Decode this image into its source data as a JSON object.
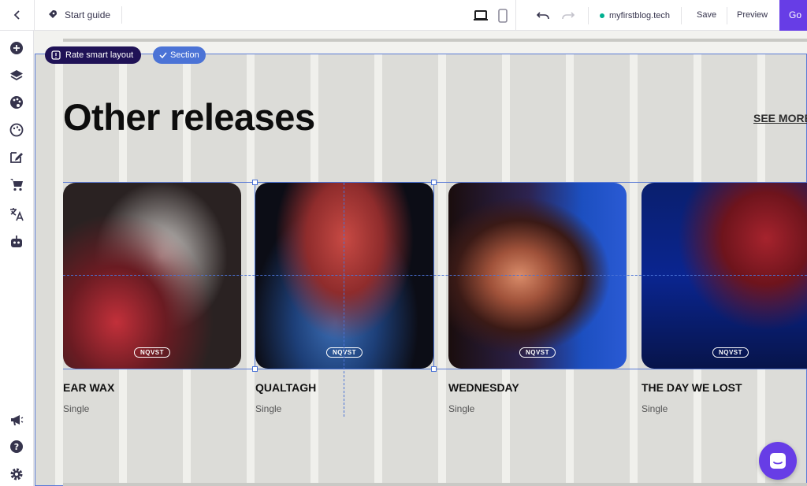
{
  "topbar": {
    "start_guide": "Start guide",
    "domain": "myfirstblog.tech",
    "save": "Save",
    "preview": "Preview",
    "go_label": "Go"
  },
  "badges": {
    "rate": "Rate smart layout",
    "section": "Section"
  },
  "content": {
    "heading": "Other releases",
    "see_more": "SEE MORE"
  },
  "cards": [
    {
      "title": "EAR WAX",
      "subtitle": "Single",
      "label": "NQVST"
    },
    {
      "title": "QUALTAGH",
      "subtitle": "Single",
      "label": "NQVST"
    },
    {
      "title": "WEDNESDAY",
      "subtitle": "Single",
      "label": "NQVST"
    },
    {
      "title": "THE DAY WE LOST",
      "subtitle": "Single",
      "label": "NQVST"
    }
  ],
  "colors": {
    "brand": "#673de6",
    "selection": "#4b73d6",
    "rate_badge": "#1f1256"
  },
  "sidebar_icons": [
    "add-icon",
    "layers-icon",
    "palette-icon",
    "theme-icon",
    "edit-icon",
    "cart-icon",
    "translate-icon",
    "robot-icon",
    "megaphone-icon",
    "help-icon",
    "settings-icon"
  ]
}
